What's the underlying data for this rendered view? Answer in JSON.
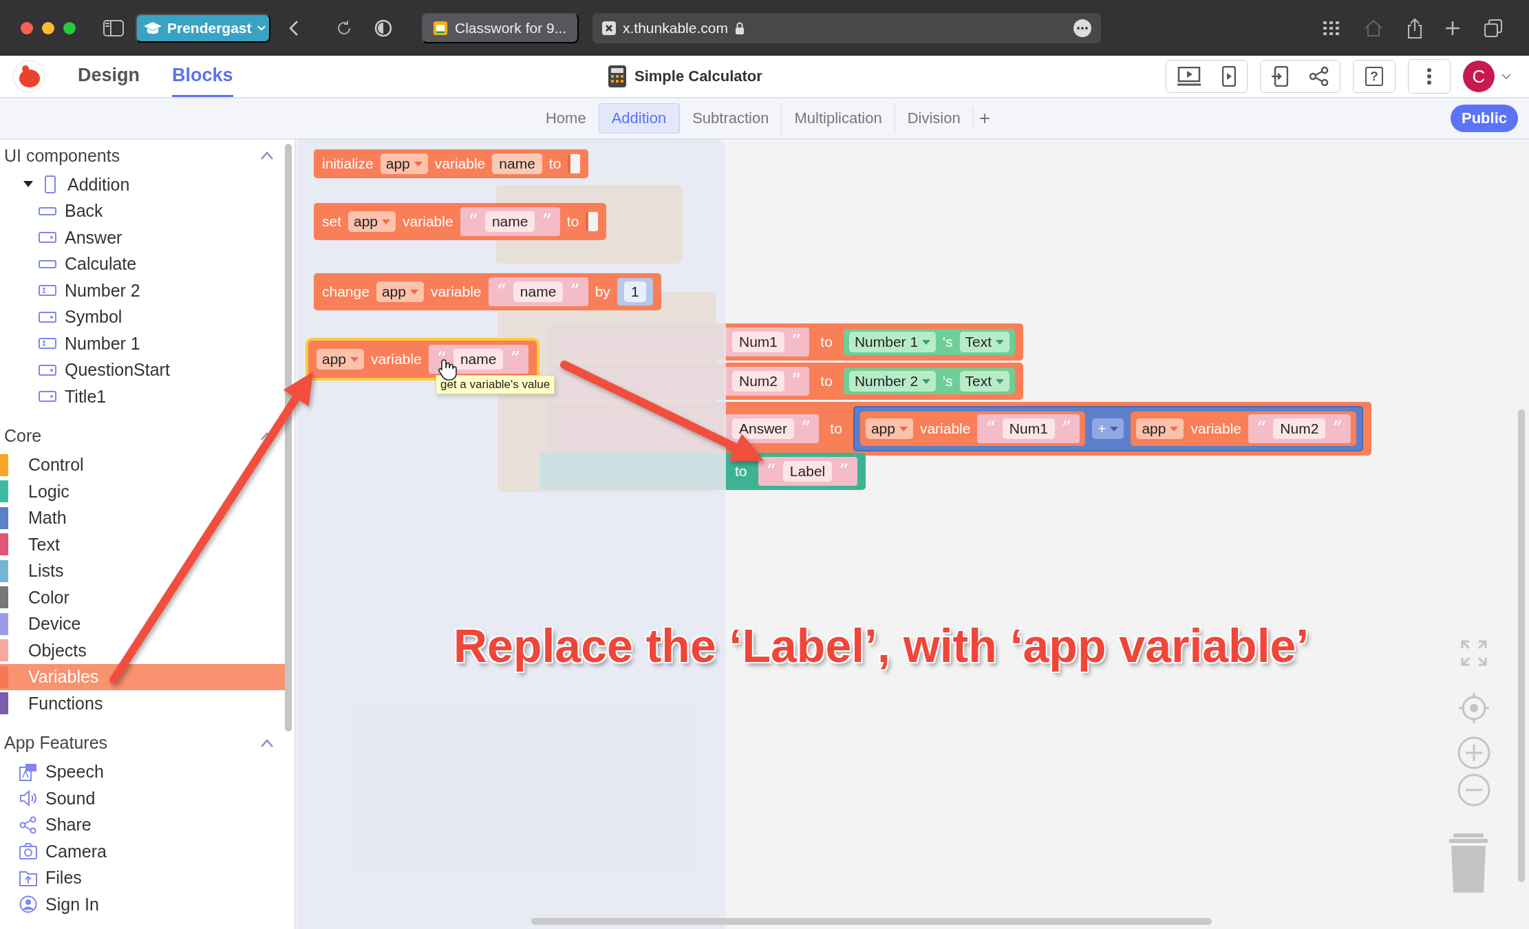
{
  "browser": {
    "profile": "Prendergast",
    "tab": "Classwork for 9...",
    "address": "x.thunkable.com"
  },
  "app_header": {
    "modes": [
      {
        "label": "Design",
        "selected": false
      },
      {
        "label": "Blocks",
        "selected": true
      }
    ],
    "project": "Simple Calculator",
    "help": "?",
    "avatar": "C"
  },
  "screens": {
    "tabs": [
      {
        "label": "Home",
        "selected": false
      },
      {
        "label": "Addition",
        "selected": true
      },
      {
        "label": "Subtraction",
        "selected": false
      },
      {
        "label": "Multiplication",
        "selected": false
      },
      {
        "label": "Division",
        "selected": false
      }
    ],
    "add": "+",
    "visibility": "Public"
  },
  "sidebar": {
    "ui_components": {
      "title": "UI components",
      "expanded": true,
      "tree": [
        {
          "label": "Addition",
          "kind": "screen",
          "expanded": true,
          "children": [
            {
              "label": "Back",
              "kind": "button"
            },
            {
              "label": "Answer",
              "kind": "label"
            },
            {
              "label": "Calculate",
              "kind": "button"
            },
            {
              "label": "Number 2",
              "kind": "textinput"
            },
            {
              "label": "Symbol",
              "kind": "label"
            },
            {
              "label": "Number 1",
              "kind": "textinput"
            },
            {
              "label": "QuestionStart",
              "kind": "label"
            },
            {
              "label": "Title1",
              "kind": "label"
            }
          ]
        }
      ]
    },
    "core": {
      "title": "Core",
      "expanded": true,
      "items": [
        {
          "label": "Control",
          "color": "#f5a623",
          "selected": false
        },
        {
          "label": "Logic",
          "color": "#3dbba0",
          "selected": false
        },
        {
          "label": "Math",
          "color": "#5b80c8",
          "selected": false
        },
        {
          "label": "Text",
          "color": "#e0557a",
          "selected": false
        },
        {
          "label": "Lists",
          "color": "#74b5d6",
          "selected": false
        },
        {
          "label": "Color",
          "color": "#777777",
          "selected": false
        },
        {
          "label": "Device",
          "color": "#9b9be8",
          "selected": false
        },
        {
          "label": "Objects",
          "color": "#f4a8a0",
          "selected": false
        },
        {
          "label": "Variables",
          "color": "#f47a55",
          "selected": true
        },
        {
          "label": "Functions",
          "color": "#7b5ea7",
          "selected": false
        }
      ]
    },
    "app_features": {
      "title": "App Features",
      "expanded": true,
      "items": [
        {
          "label": "Speech",
          "kind": "speech"
        },
        {
          "label": "Sound",
          "kind": "sound"
        },
        {
          "label": "Share",
          "kind": "share"
        },
        {
          "label": "Camera",
          "kind": "camera"
        },
        {
          "label": "Files",
          "kind": "files"
        },
        {
          "label": "Sign In",
          "kind": "signin"
        }
      ]
    }
  },
  "flyout": {
    "blocks": [
      {
        "kind": "variable",
        "selected": false,
        "parts": [
          {
            "kind": "label",
            "text": "initialize"
          },
          {
            "kind": "dropdown",
            "text": "app"
          },
          {
            "kind": "label",
            "text": "variable"
          },
          {
            "kind": "field",
            "text": "name"
          },
          {
            "kind": "label",
            "text": "to"
          },
          {
            "kind": "socket"
          }
        ]
      },
      {
        "kind": "variable",
        "selected": false,
        "parts": [
          {
            "kind": "label",
            "text": "set"
          },
          {
            "kind": "dropdown",
            "text": "app"
          },
          {
            "kind": "label",
            "text": "variable"
          },
          {
            "kind": "string",
            "open": "“",
            "value": "name",
            "close": "”"
          },
          {
            "kind": "label",
            "text": "to"
          },
          {
            "kind": "socket"
          }
        ]
      },
      {
        "kind": "variable",
        "selected": false,
        "parts": [
          {
            "kind": "label",
            "text": "change"
          },
          {
            "kind": "dropdown",
            "text": "app"
          },
          {
            "kind": "label",
            "text": "variable"
          },
          {
            "kind": "string",
            "open": "“",
            "value": "name",
            "close": "”"
          },
          {
            "kind": "label",
            "text": "by"
          },
          {
            "kind": "number",
            "value": "1"
          }
        ]
      },
      {
        "kind": "variable",
        "selected": true,
        "parts": [
          {
            "kind": "dropdown",
            "text": "app"
          },
          {
            "kind": "label",
            "text": "variable"
          },
          {
            "kind": "string",
            "open": "“",
            "value": "name",
            "close": "”"
          }
        ]
      }
    ],
    "tooltip": "get a variable's value"
  },
  "workspace": {
    "rows": [
      {
        "kind": "variable",
        "parts": [
          {
            "kind": "string",
            "value": "Num1",
            "close": "”"
          },
          {
            "kind": "label",
            "text": "to"
          },
          {
            "kind": "component",
            "parts": [
              {
                "kind": "dropdown",
                "text": "Number 1"
              },
              {
                "kind": "label",
                "text": "'s"
              },
              {
                "kind": "dropdown",
                "text": "Text"
              }
            ]
          }
        ]
      },
      {
        "kind": "variable",
        "parts": [
          {
            "kind": "string",
            "value": "Num2",
            "close": "”"
          },
          {
            "kind": "label",
            "text": "to"
          },
          {
            "kind": "component",
            "parts": [
              {
                "kind": "dropdown",
                "text": "Number 2"
              },
              {
                "kind": "label",
                "text": "'s"
              },
              {
                "kind": "dropdown",
                "text": "Text"
              }
            ]
          }
        ]
      },
      {
        "kind": "variable",
        "parts": [
          {
            "kind": "string",
            "value": "Answer",
            "close": "”"
          },
          {
            "kind": "label",
            "text": "to"
          },
          {
            "kind": "math",
            "parts": [
              {
                "kind": "variable",
                "parts": [
                  {
                    "kind": "dropdown",
                    "text": "app"
                  },
                  {
                    "kind": "label",
                    "text": "variable"
                  },
                  {
                    "kind": "string",
                    "open": "“",
                    "value": "Num1",
                    "close": "”"
                  }
                ]
              },
              {
                "kind": "dropdown",
                "text": "+"
              },
              {
                "kind": "variable",
                "parts": [
                  {
                    "kind": "dropdown",
                    "text": "app"
                  },
                  {
                    "kind": "label",
                    "text": "variable"
                  },
                  {
                    "kind": "string",
                    "open": "“",
                    "value": "Num2",
                    "close": "”"
                  }
                ]
              }
            ]
          }
        ]
      },
      {
        "kind": "component_setter",
        "parts": [
          {
            "kind": "label",
            "text": "to"
          },
          {
            "kind": "string",
            "open": "“",
            "value": "Label",
            "close": "”"
          }
        ]
      }
    ]
  },
  "annotation": "Replace the ‘Label’, with ‘app variable’"
}
